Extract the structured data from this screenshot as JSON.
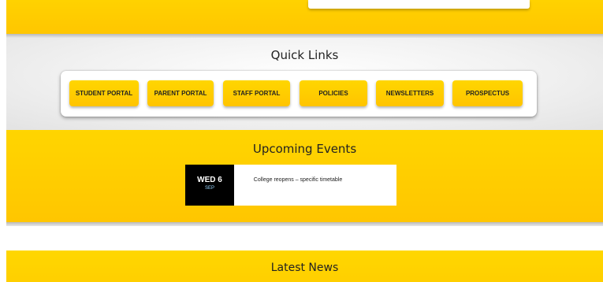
{
  "quick_links": {
    "heading": "Quick Links",
    "items": [
      {
        "label": "STUDENT PORTAL"
      },
      {
        "label": "PARENT PORTAL"
      },
      {
        "label": "STAFF PORTAL"
      },
      {
        "label": "POLICIES"
      },
      {
        "label": "NEWSLETTERS"
      },
      {
        "label": "PROSPECTUS"
      }
    ]
  },
  "events": {
    "heading": "Upcoming Events",
    "items": [
      {
        "day": "WED 6",
        "month": "SEP",
        "title": "College reopens – specific timetable"
      }
    ]
  },
  "news": {
    "heading": "Latest News"
  },
  "colors": {
    "accent": "#ffc600",
    "event_date_bg": "#000000"
  }
}
